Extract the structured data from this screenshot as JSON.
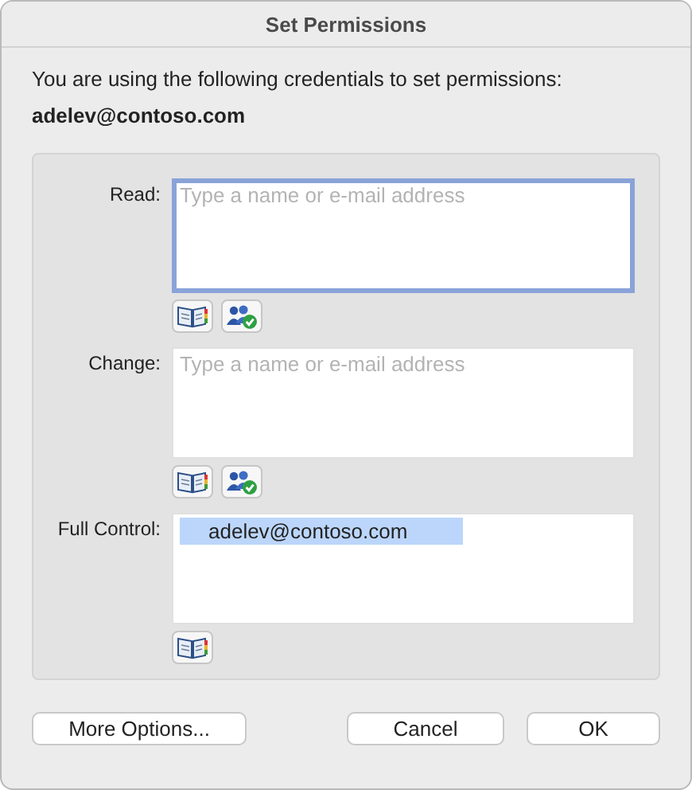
{
  "window": {
    "title": "Set Permissions"
  },
  "intro": "You are using the following credentials to set permissions:",
  "account": "adelev@contoso.com",
  "permissions": [
    {
      "label": "Read:",
      "placeholder": "Type a name or e-mail address",
      "focused": true,
      "tools": [
        {
          "kind": "address-book"
        },
        {
          "kind": "check-names"
        }
      ]
    },
    {
      "label": "Change:",
      "placeholder": "Type a name or e-mail address",
      "focused": false,
      "tools": [
        {
          "kind": "address-book"
        },
        {
          "kind": "check-names"
        }
      ]
    },
    {
      "label": "Full Control:",
      "focused": false,
      "entries": [
        {
          "name": "adelev@contoso.com",
          "selected": true
        }
      ],
      "tools": [
        {
          "kind": "address-book"
        }
      ]
    }
  ],
  "buttons": [
    "More Options...",
    "Cancel",
    "OK"
  ]
}
